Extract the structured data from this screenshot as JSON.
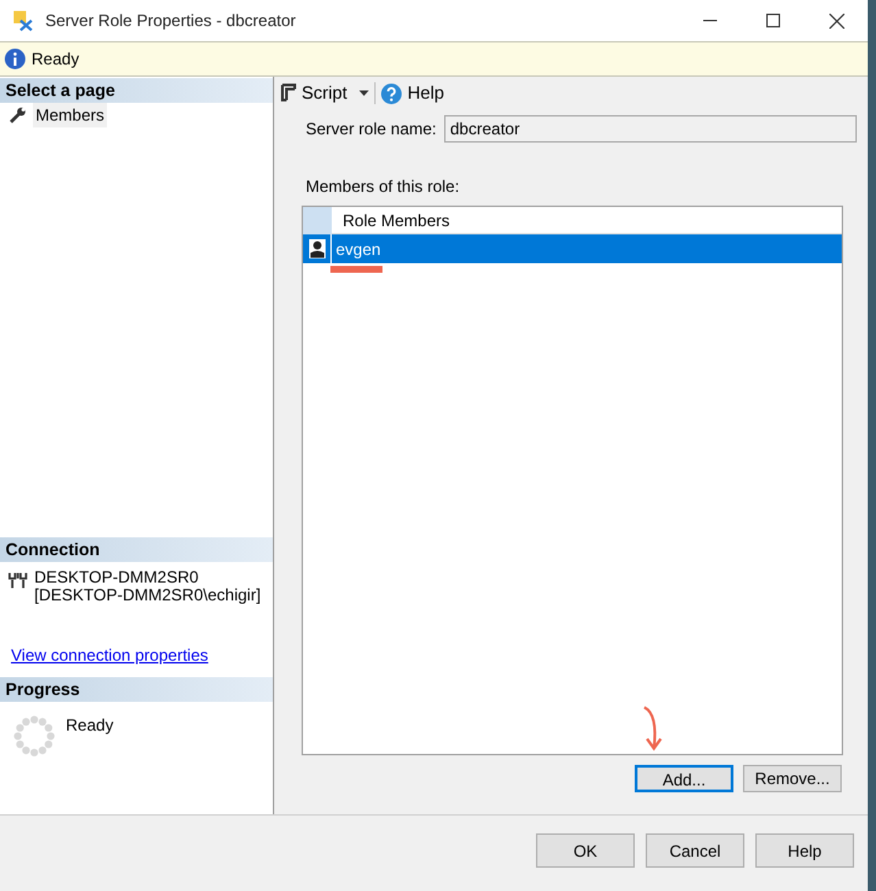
{
  "window": {
    "title": "Server Role Properties - dbcreator"
  },
  "info_bar": {
    "text": "Ready"
  },
  "sidebar": {
    "select_page": {
      "title": "Select a page",
      "items": [
        {
          "label": "Members",
          "selected": true
        }
      ]
    },
    "connection": {
      "title": "Connection",
      "server": "DESKTOP-DMM2SR0",
      "user": "[DESKTOP-DMM2SR0\\echigir]",
      "link": "View connection properties"
    },
    "progress": {
      "title": "Progress",
      "status": "Ready"
    }
  },
  "toolbar": {
    "script": "Script",
    "help": "Help"
  },
  "role_name": {
    "label": "Server role name:",
    "value": "dbcreator"
  },
  "members": {
    "label": "Members of this role:",
    "column": "Role Members",
    "rows": [
      {
        "name": "evgen",
        "selected": true
      }
    ]
  },
  "member_buttons": [
    {
      "label": "Add...",
      "focused": true
    },
    {
      "label": "Remove...",
      "focused": false
    }
  ],
  "buttons": [
    {
      "label": "OK"
    },
    {
      "label": "Cancel"
    },
    {
      "label": "Help"
    }
  ]
}
